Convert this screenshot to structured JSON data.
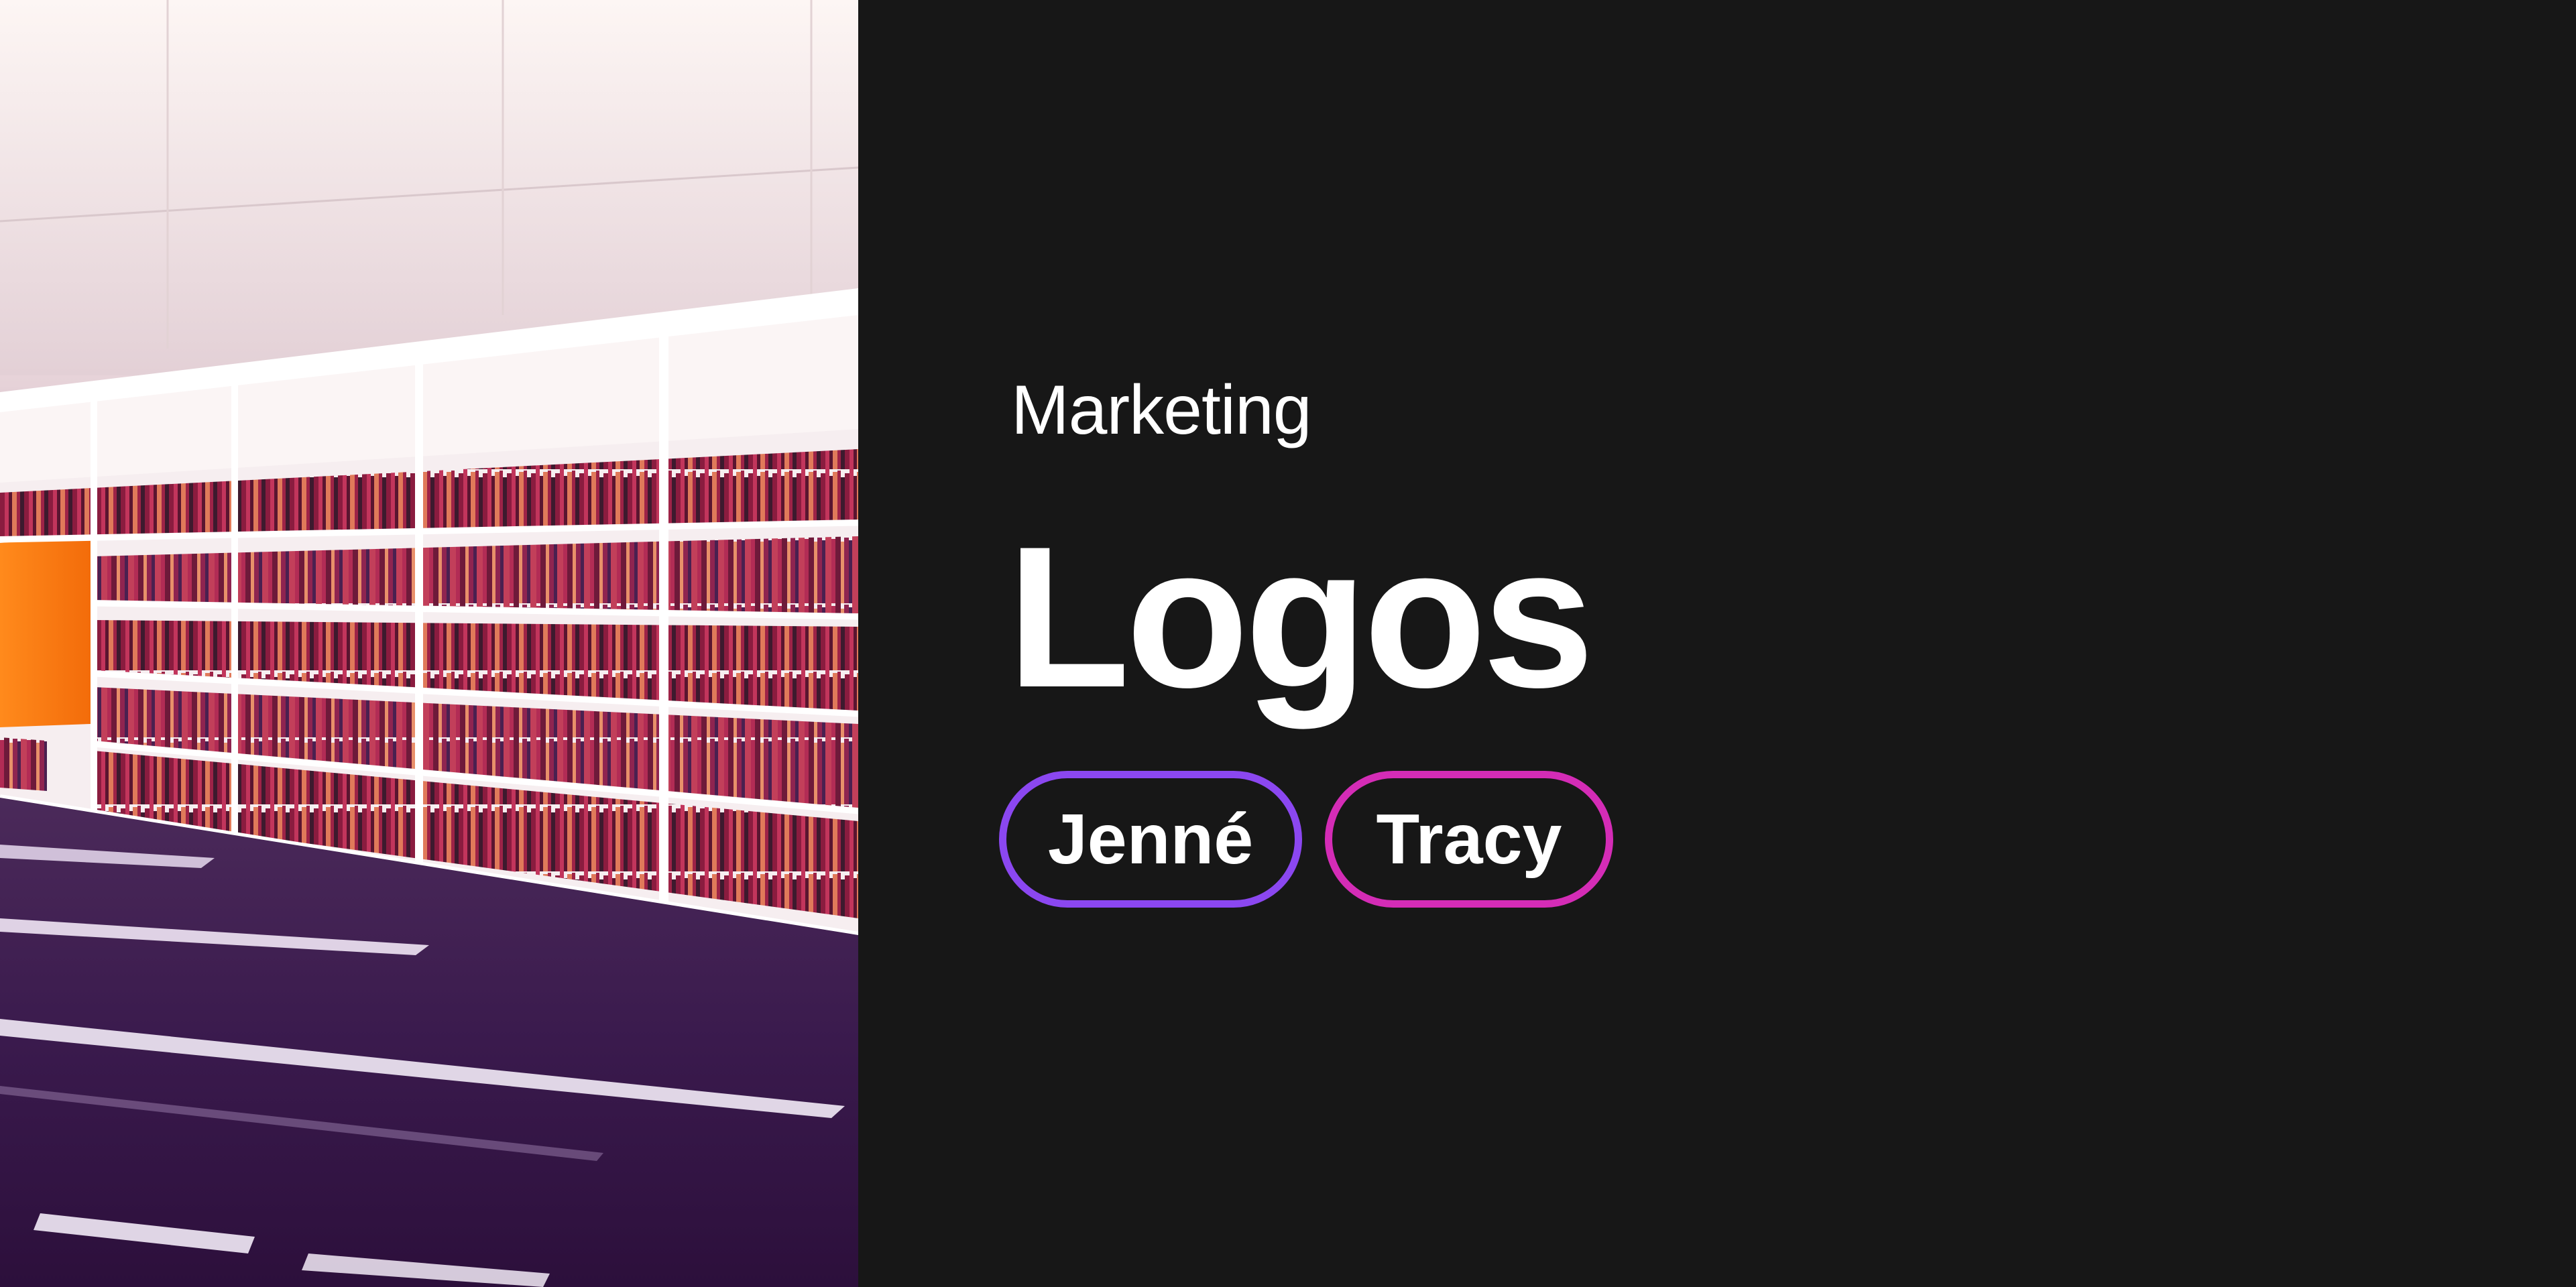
{
  "hero": {
    "eyebrow": "Marketing",
    "title": "Logos",
    "tags": [
      {
        "label": "Jenné",
        "color": "#8b47f0"
      },
      {
        "label": "Tracy",
        "color": "#d42cb6"
      }
    ]
  },
  "colors": {
    "background": "#171717",
    "text": "#ffffff"
  },
  "image": {
    "subject": "library-bookshelf-photo"
  }
}
